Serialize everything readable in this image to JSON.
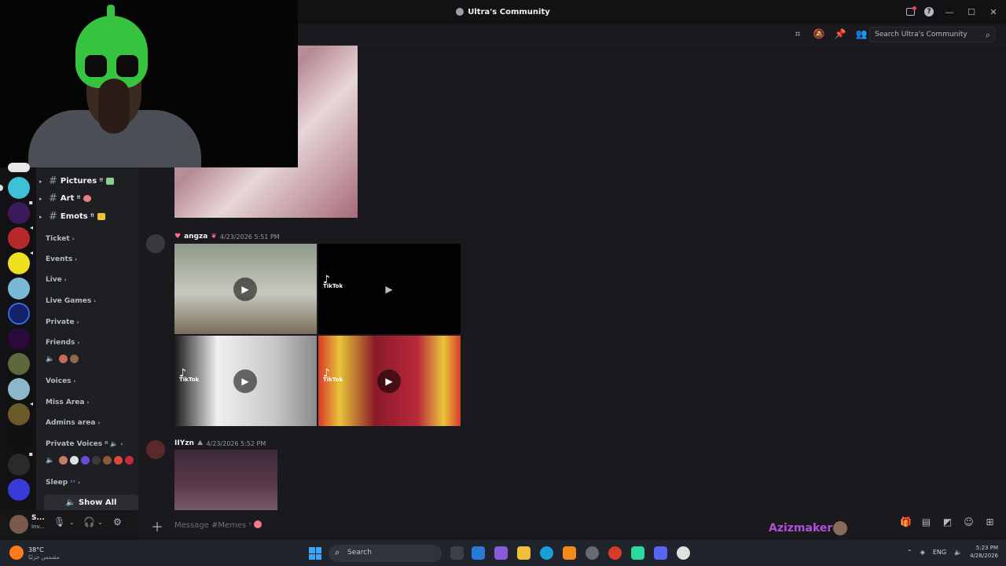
{
  "window": {
    "title": "Ultra's Community"
  },
  "header": {
    "search_placeholder": "Search Ultra's Community"
  },
  "channels": [
    {
      "label": "Pictures ᵎᵎ"
    },
    {
      "label": "Art ᵎᵎ"
    },
    {
      "label": "Emots ᵎᵎ"
    }
  ],
  "categories": [
    {
      "label": "Ticket"
    },
    {
      "label": "Events"
    },
    {
      "label": "Live"
    },
    {
      "label": "Live Games"
    },
    {
      "label": "Private"
    },
    {
      "label": "Friends"
    },
    {
      "label": "Voices"
    },
    {
      "label": "Miss Area"
    },
    {
      "label": "Admins area"
    },
    {
      "label": "Private Voices ᵎᵎ"
    },
    {
      "label": "Sleep"
    }
  ],
  "show_all_label": "Show All",
  "messages": [
    {
      "author": "angza",
      "timestamp": "4/23/2026 5:51 PM"
    },
    {
      "author": "IIYzn",
      "timestamp": "4/23/2026 5:52 PM"
    }
  ],
  "tiktok": {
    "label": "TikTok"
  },
  "user": {
    "name": "S...",
    "status": "Inv..."
  },
  "composer": {
    "placeholder": "Message #Memes ᵎᵎ"
  },
  "overlay_brand": "Azizmaker",
  "taskbar": {
    "search_label": "Search",
    "weather_temp": "38°C",
    "weather_desc": "مشمس جزئيًا",
    "lang": "ENG",
    "time": "5:23 PM",
    "date": "4/28/2026"
  },
  "icons": [
    "discord-app-icon",
    "inbox-icon",
    "help-icon",
    "minimize-icon",
    "maximize-icon",
    "close-icon",
    "threads-icon",
    "mute-icon",
    "pin-icon",
    "members-icon",
    "search-icon",
    "plus-icon",
    "gift-icon",
    "gif-icon",
    "sticker-icon",
    "emoji-icon",
    "apps-icon",
    "mic-icon",
    "headphones-icon",
    "settings-icon",
    "play-icon",
    "speaker-icon"
  ],
  "colors": {
    "accent": "#b04fd8",
    "background": "#1a1a1e",
    "rail": "#121214"
  }
}
